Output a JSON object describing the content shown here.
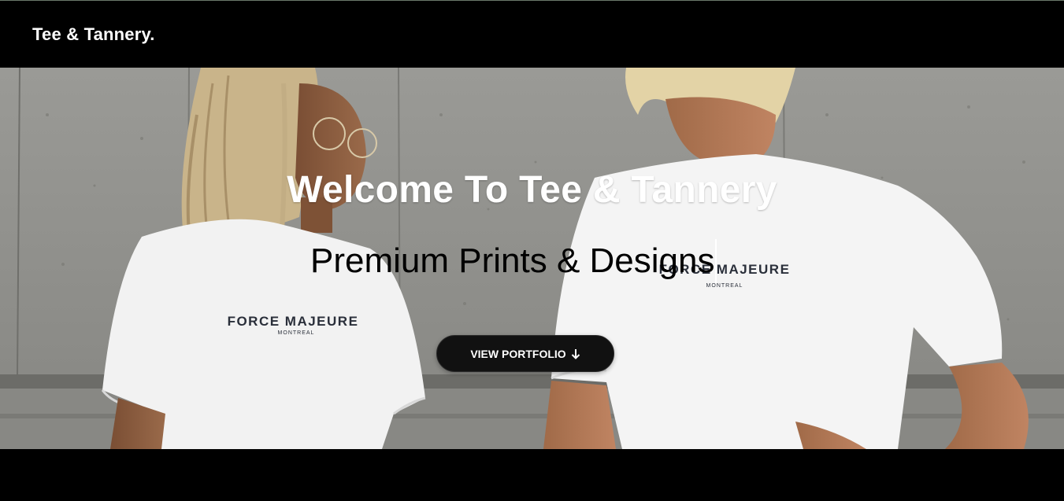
{
  "nav": {
    "brand": "Tee & Tannery."
  },
  "hero": {
    "title": "Welcome To Tee & Tannery",
    "subtitle": "Premium Prints & Designs",
    "cta_label": "VIEW PORTFOLIO",
    "cta_icon": "arrow-down-icon",
    "shirt_print_left": "FORCE MAJEURE",
    "shirt_print_left_sub": "MONTREAL",
    "shirt_print_right": "FORCE MAJEURE",
    "shirt_print_right_sub": "MONTREAL"
  },
  "colors": {
    "nav_bg": "#000000",
    "cta_bg": "#111111",
    "hero_title": "#ffffff",
    "hero_subtitle": "#000000"
  }
}
